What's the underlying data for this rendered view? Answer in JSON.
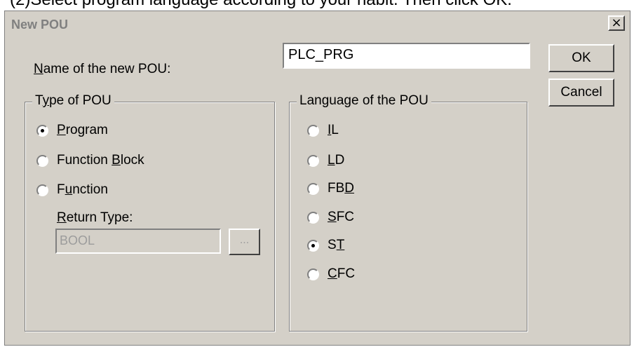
{
  "caption": "(2)Select program language according to your habit. Then click OK.",
  "dialog": {
    "title": "New POU",
    "close_glyph": "×",
    "name_label_u": "N",
    "name_label_rest": "ame of the new POU:",
    "name_value": "PLC_PRG",
    "ok_label": "OK",
    "cancel_label": "Cancel"
  },
  "type_group": {
    "title_pre": "T",
    "title_u": "y",
    "title_rest": "pe of POU",
    "options": [
      {
        "pre": "",
        "u": "P",
        "rest": "rogram",
        "checked": true
      },
      {
        "pre": "Function ",
        "u": "B",
        "rest": "lock",
        "checked": false
      },
      {
        "pre": "F",
        "u": "u",
        "rest": "nction",
        "checked": false
      }
    ],
    "return_label_u": "R",
    "return_label_rest": "eturn Type:",
    "return_value": "BOOL",
    "browse_label": "..."
  },
  "lang_group": {
    "title": "Language of the POU",
    "options": [
      {
        "pre": "",
        "u": "I",
        "rest": "L",
        "checked": false
      },
      {
        "pre": "",
        "u": "L",
        "rest": "D",
        "checked": false
      },
      {
        "pre": "FB",
        "u": "D",
        "rest": "",
        "checked": false
      },
      {
        "pre": "",
        "u": "S",
        "rest": "FC",
        "checked": false
      },
      {
        "pre": "S",
        "u": "T",
        "rest": "",
        "checked": true
      },
      {
        "pre": "",
        "u": "C",
        "rest": "FC",
        "checked": false
      }
    ]
  }
}
